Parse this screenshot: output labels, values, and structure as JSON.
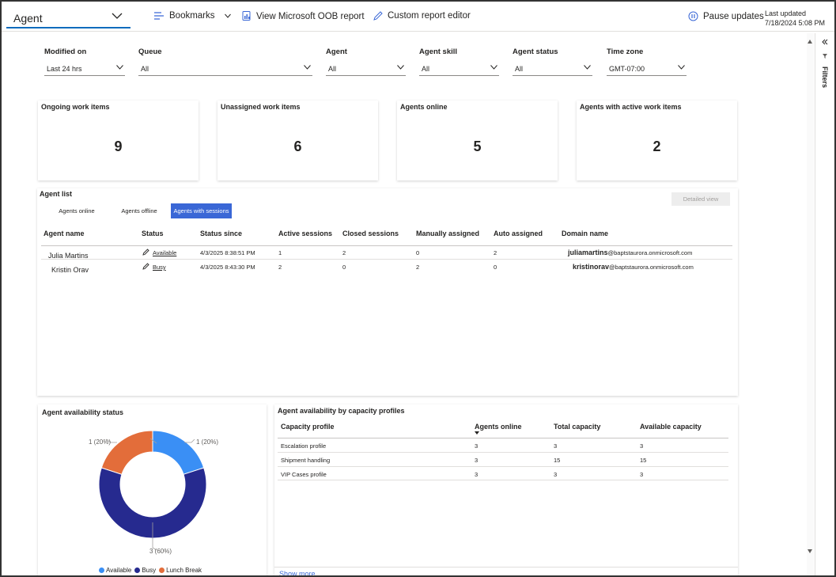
{
  "header": {
    "report_name": "Agent",
    "bookmarks": "Bookmarks",
    "oob_report": "View Microsoft OOB report",
    "custom_editor": "Custom report editor",
    "pause": "Pause updates",
    "last_updated_label": "Last updated",
    "last_updated_value": "7/18/2024 5:08 PM"
  },
  "filters": [
    {
      "label": "Modified on",
      "value": "Last 24 hrs"
    },
    {
      "label": "Queue",
      "value": "All"
    },
    {
      "label": "Agent",
      "value": "All"
    },
    {
      "label": "Agent skill",
      "value": "All"
    },
    {
      "label": "Agent status",
      "value": "All"
    },
    {
      "label": "Time zone",
      "value": "GMT-07:00"
    }
  ],
  "cards": [
    {
      "title": "Ongoing work items",
      "value": "9"
    },
    {
      "title": "Unassigned work items",
      "value": "6"
    },
    {
      "title": "Agents online",
      "value": "5"
    },
    {
      "title": "Agents with active work items",
      "value": "2"
    }
  ],
  "agent_list": {
    "title": "Agent list",
    "tabs": [
      "Agents online",
      "Agents offline",
      "Agents with sessions"
    ],
    "detailed_view": "Detailed view",
    "columns": [
      "Agent name",
      "Status",
      "Status since",
      "Active sessions",
      "Closed sessions",
      "Manually assigned",
      "Auto assigned",
      "Domain name"
    ],
    "rows": [
      {
        "name": "Julia Martins",
        "status": "Available",
        "since": "4/3/2025 8:38:51 PM",
        "active": "1",
        "closed": "2",
        "manual": "0",
        "auto": "2",
        "user": "juliamartins",
        "domain": "@baptstaurora.onmicrosoft.com"
      },
      {
        "name": "Kristin Orav",
        "status": "Busy",
        "since": "4/3/2025 8:43:30 PM",
        "active": "2",
        "closed": "0",
        "manual": "2",
        "auto": "0",
        "user": "kristinorav",
        "domain": "@baptstaurora.onmicrosoft.com"
      }
    ]
  },
  "availability": {
    "title": "Agent availability status",
    "labels": {
      "available": "1 (20%)",
      "lunch": "1 (20%)",
      "busy": "3 (60%)"
    },
    "legend": [
      "Available",
      "Busy",
      "Lunch Break"
    ],
    "colors": {
      "available": "#3a8ff5",
      "busy": "#262a8f",
      "lunch": "#e36d3a"
    }
  },
  "chart_data": {
    "type": "pie",
    "categories": [
      "Available",
      "Busy",
      "Lunch Break"
    ],
    "values": [
      1,
      3,
      1
    ],
    "percent": [
      20,
      60,
      20
    ],
    "title": "Agent availability status",
    "legend_position": "bottom"
  },
  "capacity": {
    "title": "Agent availability by capacity profiles",
    "columns": [
      "Capacity profile",
      "Agents online",
      "Total capacity",
      "Available capacity"
    ],
    "rows": [
      [
        "Escalation profile",
        "3",
        "3",
        "3"
      ],
      [
        "Shipment handling",
        "3",
        "15",
        "15"
      ],
      [
        "VIP Cases profile",
        "3",
        "3",
        "3"
      ]
    ],
    "show_more": "Show more"
  },
  "rail": {
    "label": "Filters"
  }
}
